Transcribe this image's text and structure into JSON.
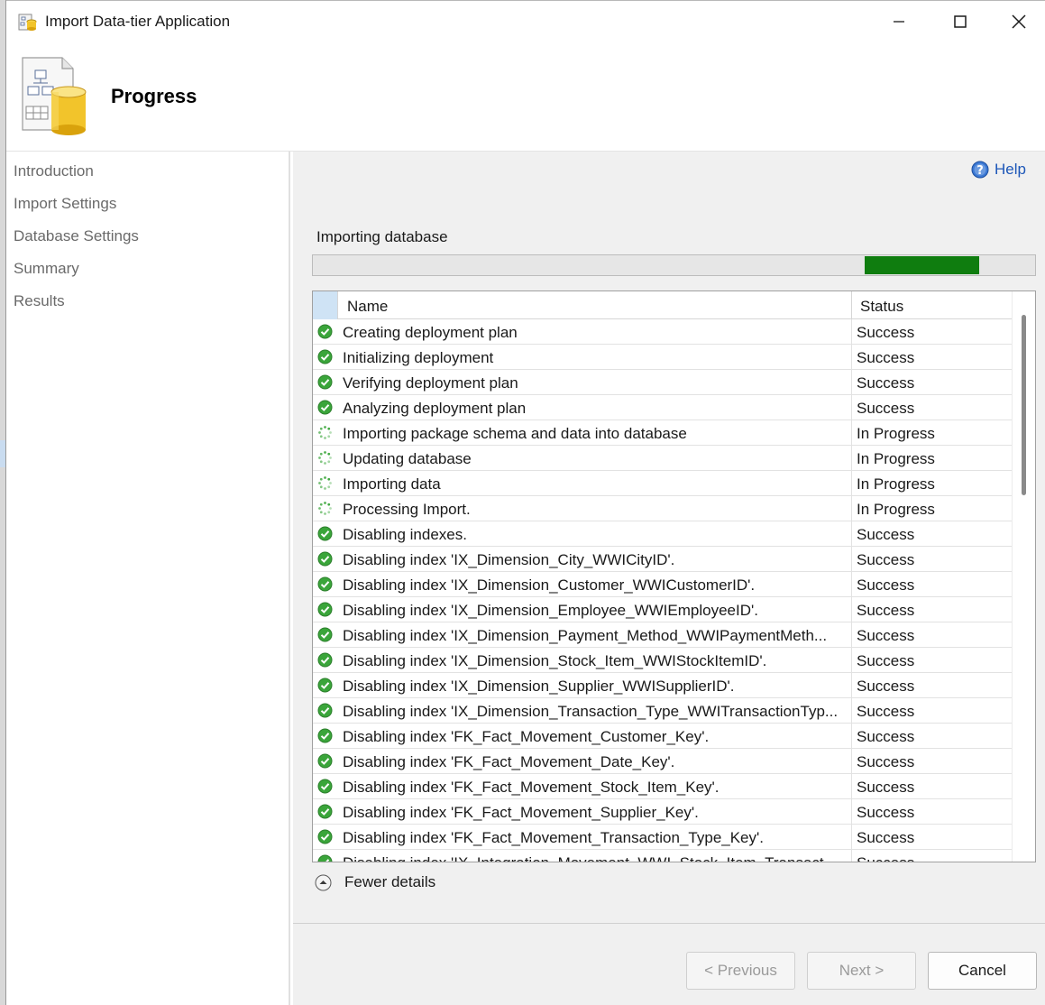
{
  "window": {
    "title": "Import Data-tier Application"
  },
  "header": {
    "title": "Progress"
  },
  "sidebar": {
    "items": [
      {
        "label": "Introduction"
      },
      {
        "label": "Import Settings"
      },
      {
        "label": "Database Settings"
      },
      {
        "label": "Summary"
      },
      {
        "label": "Results"
      }
    ]
  },
  "help": {
    "label": "Help"
  },
  "operation": {
    "label": "Importing database",
    "progress_segment": {
      "start": 0.764,
      "end": 0.922
    }
  },
  "grid": {
    "columns": {
      "name": "Name",
      "status": "Status"
    },
    "rows": [
      {
        "name": "Creating deployment plan",
        "status": "Success",
        "icon": "success-icon"
      },
      {
        "name": "Initializing deployment",
        "status": "Success",
        "icon": "success-icon"
      },
      {
        "name": "Verifying deployment plan",
        "status": "Success",
        "icon": "success-icon"
      },
      {
        "name": "Analyzing deployment plan",
        "status": "Success",
        "icon": "success-icon"
      },
      {
        "name": "Importing package schema and data into database",
        "status": "In Progress",
        "icon": "in-progress-icon"
      },
      {
        "name": "Updating database",
        "status": "In Progress",
        "icon": "in-progress-icon"
      },
      {
        "name": "Importing data",
        "status": "In Progress",
        "icon": "in-progress-icon"
      },
      {
        "name": "Processing Import.",
        "status": "In Progress",
        "icon": "in-progress-icon"
      },
      {
        "name": "Disabling indexes.",
        "status": "Success",
        "icon": "success-icon"
      },
      {
        "name": "Disabling index 'IX_Dimension_City_WWICityID'.",
        "status": "Success",
        "icon": "success-icon"
      },
      {
        "name": "Disabling index 'IX_Dimension_Customer_WWICustomerID'.",
        "status": "Success",
        "icon": "success-icon"
      },
      {
        "name": "Disabling index 'IX_Dimension_Employee_WWIEmployeeID'.",
        "status": "Success",
        "icon": "success-icon"
      },
      {
        "name": "Disabling index 'IX_Dimension_Payment_Method_WWIPaymentMeth...",
        "status": "Success",
        "icon": "success-icon"
      },
      {
        "name": "Disabling index 'IX_Dimension_Stock_Item_WWIStockItemID'.",
        "status": "Success",
        "icon": "success-icon"
      },
      {
        "name": "Disabling index 'IX_Dimension_Supplier_WWISupplierID'.",
        "status": "Success",
        "icon": "success-icon"
      },
      {
        "name": "Disabling index 'IX_Dimension_Transaction_Type_WWITransactionTyp...",
        "status": "Success",
        "icon": "success-icon"
      },
      {
        "name": "Disabling index 'FK_Fact_Movement_Customer_Key'.",
        "status": "Success",
        "icon": "success-icon"
      },
      {
        "name": "Disabling index 'FK_Fact_Movement_Date_Key'.",
        "status": "Success",
        "icon": "success-icon"
      },
      {
        "name": "Disabling index 'FK_Fact_Movement_Stock_Item_Key'.",
        "status": "Success",
        "icon": "success-icon"
      },
      {
        "name": "Disabling index 'FK_Fact_Movement_Supplier_Key'.",
        "status": "Success",
        "icon": "success-icon"
      },
      {
        "name": "Disabling index 'FK_Fact_Movement_Transaction_Type_Key'.",
        "status": "Success",
        "icon": "success-icon"
      },
      {
        "name": "Disabling index 'IX_Integration_Movement_WWI_Stock_Item_Transact...",
        "status": "Success",
        "icon": "success-icon"
      }
    ]
  },
  "details_toggle": {
    "label": "Fewer details",
    "icon": "collapse-up-icon"
  },
  "buttons": {
    "previous": "< Previous",
    "next": "Next >",
    "cancel": "Cancel"
  },
  "colors": {
    "progress_fill": "#0f7d0f",
    "success": "#3aa53a",
    "in_progress": "#2ea02e",
    "help_link": "#1d57b8",
    "header_corner": "#cfe3f5"
  }
}
